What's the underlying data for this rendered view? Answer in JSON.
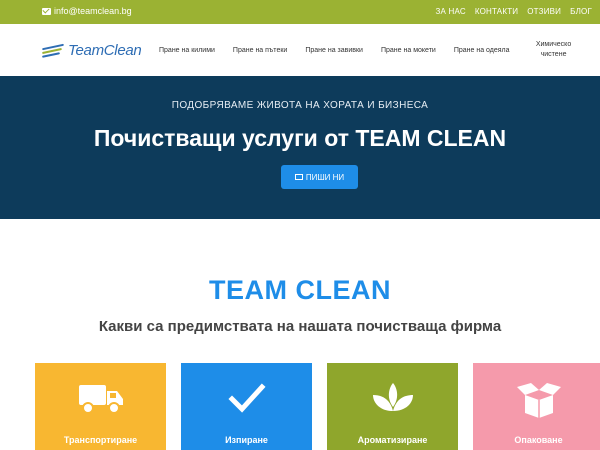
{
  "topbar": {
    "email": "info@teamclean.bg",
    "links": [
      "ЗА НАС",
      "КОНТАКТИ",
      "ОТЗИВИ",
      "БЛОГ"
    ]
  },
  "logo": {
    "text": "TeamClean"
  },
  "nav": {
    "items": [
      "Пране на килими",
      "Пране на пътеки",
      "Пране на завивки",
      "Пране на мокети",
      "Пране на одеяла",
      "Химическо чистене"
    ]
  },
  "hero": {
    "subtitle": "ПОДОБРЯВАМЕ ЖИВОТА НА ХОРАТА И БИЗНЕСА",
    "title": "Почистващи услуги от TEAM CLEAN",
    "button": "ПИШИ НИ"
  },
  "section": {
    "title": "TEAM CLEAN",
    "subtitle": "Какви са предимствата на нашата почистваща фирма"
  },
  "features": [
    {
      "label": "Транспортиране",
      "icon": "truck-icon"
    },
    {
      "label": "Изпиране",
      "icon": "checkmark-icon"
    },
    {
      "label": "Ароматизиране",
      "icon": "leaf-icon"
    },
    {
      "label": "Опаковане",
      "icon": "box-icon"
    }
  ],
  "colors": {
    "topbar": "#9bb233",
    "hero": "#0d3b5b",
    "accent": "#1e8de8"
  }
}
